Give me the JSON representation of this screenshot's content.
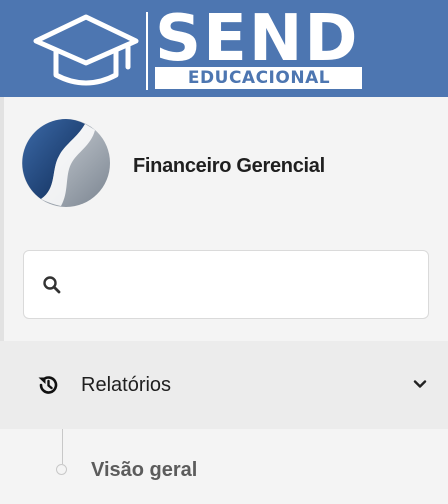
{
  "header": {
    "logo_word": "SEND",
    "logo_subword": "EDUCACIONAL",
    "background_color": "#4d76b1"
  },
  "profile": {
    "name": "Financeiro Gerencial",
    "avatar_icon": "company-logo-icon"
  },
  "search": {
    "value": "",
    "placeholder": "",
    "icon": "search-icon"
  },
  "menu": {
    "items": [
      {
        "label": "Relatórios",
        "icon": "history-icon",
        "expanded": true,
        "children": [
          {
            "label": "Visão geral"
          }
        ]
      }
    ]
  }
}
